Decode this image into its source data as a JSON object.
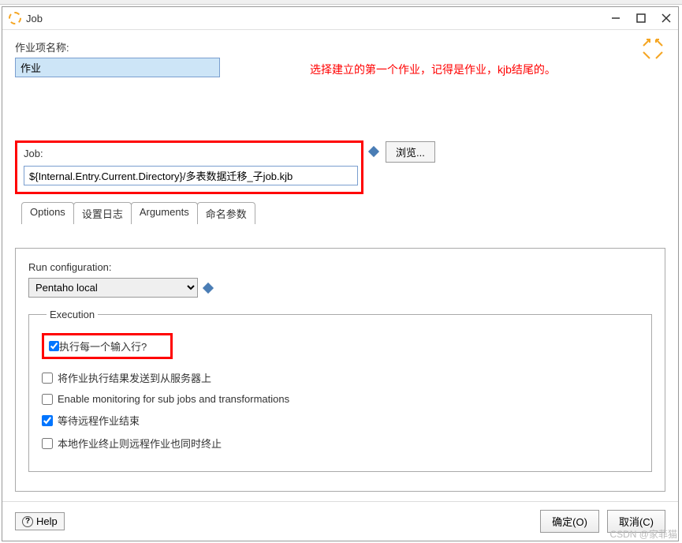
{
  "dialog": {
    "title": "Job"
  },
  "form": {
    "name_label": "作业项名称:",
    "name_value": "作业",
    "job_label": "Job:",
    "job_value": "${Internal.Entry.Current.Directory}/多表数据迁移_子job.kjb",
    "browse_label": "浏览..."
  },
  "annotation": {
    "text": "选择建立的第一个作业，记得是作业，kjb结尾的。"
  },
  "tabs": {
    "items": [
      {
        "label": "Options"
      },
      {
        "label": "设置日志"
      },
      {
        "label": "Arguments"
      },
      {
        "label": "命名参数"
      }
    ]
  },
  "options_tab": {
    "run_config_label": "Run configuration:",
    "run_config_value": "Pentaho local",
    "execution_legend": "Execution",
    "checkboxes": [
      {
        "label": "执行每一个输入行?",
        "checked": true,
        "highlighted": true
      },
      {
        "label": "将作业执行结果发送到从服务器上",
        "checked": false
      },
      {
        "label": "Enable monitoring for sub jobs and transformations",
        "checked": false
      },
      {
        "label": "等待远程作业结束",
        "checked": true
      },
      {
        "label": "本地作业终止则远程作业也同时终止",
        "checked": false
      }
    ]
  },
  "footer": {
    "help_label": "Help",
    "ok_label": "确定(O)",
    "cancel_label": "取消(C)"
  },
  "watermark": "CSDN @家菲猫"
}
